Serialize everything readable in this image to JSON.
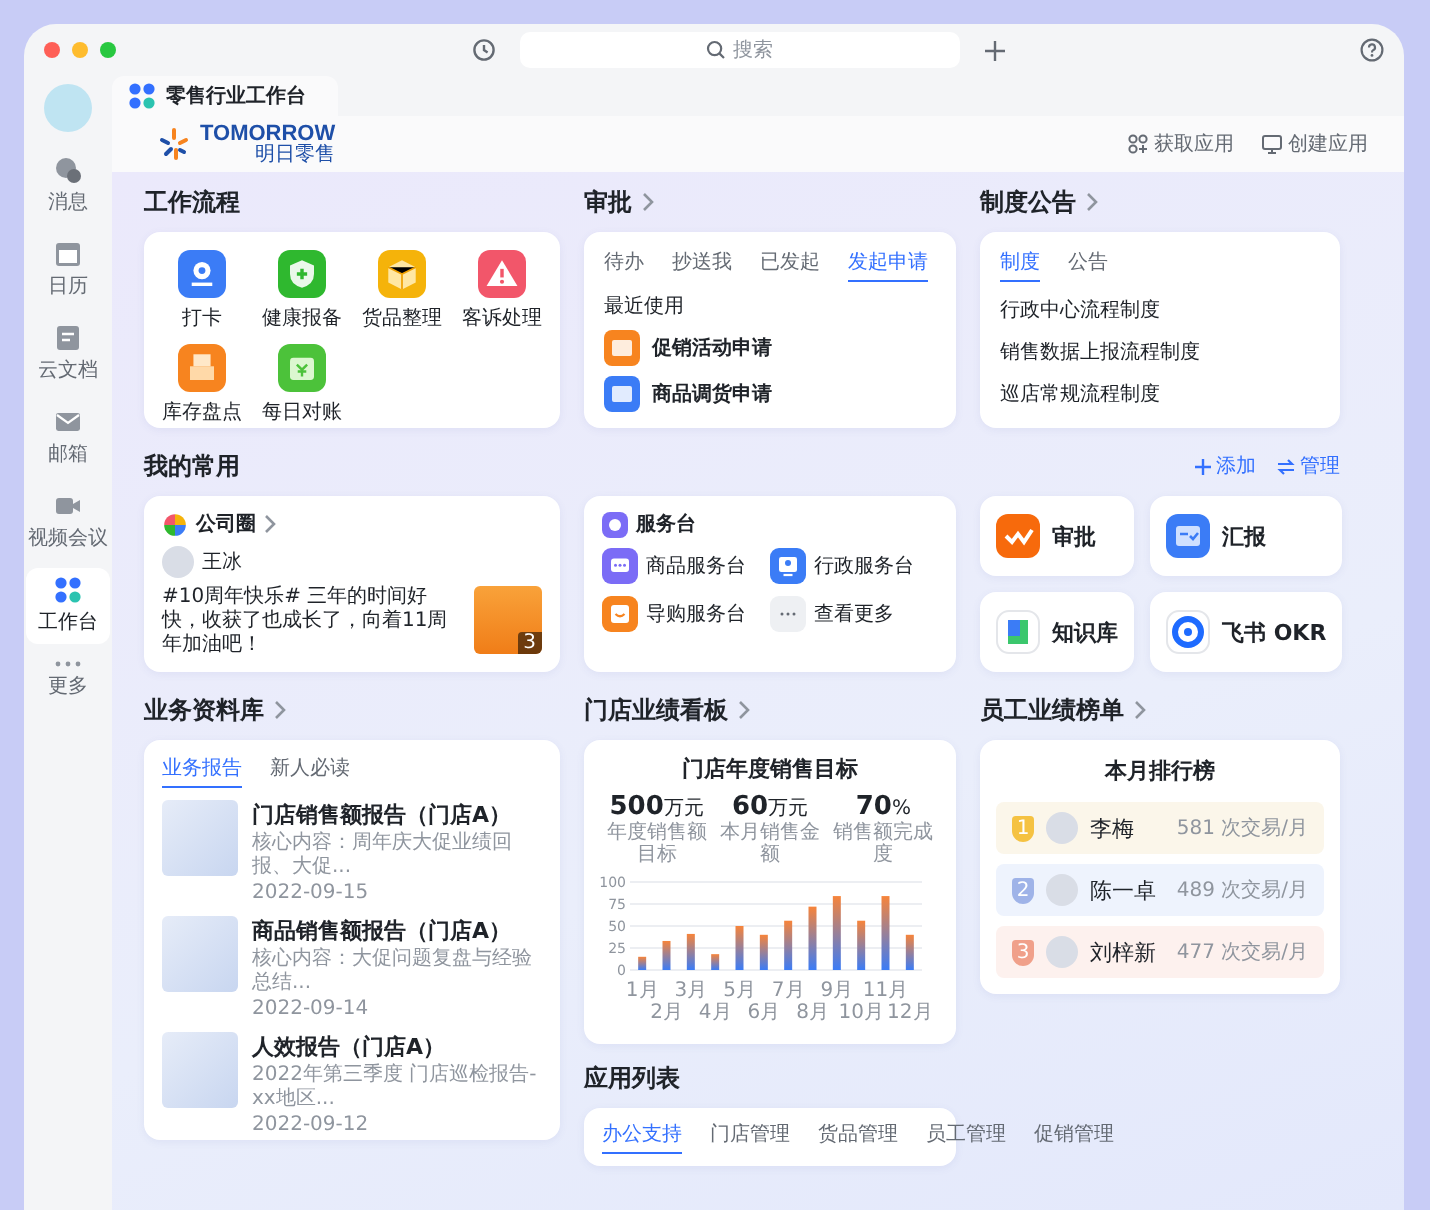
{
  "window": {
    "search_placeholder": "搜索",
    "tab_title": "零售行业工作台"
  },
  "sidebar": {
    "items": [
      {
        "label": "消息",
        "kind": "chat",
        "selected": false
      },
      {
        "label": "日历",
        "kind": "calendar",
        "selected": false
      },
      {
        "label": "云文档",
        "kind": "doc",
        "selected": false
      },
      {
        "label": "邮箱",
        "kind": "mail",
        "selected": false
      },
      {
        "label": "视频会议",
        "kind": "video",
        "selected": false
      },
      {
        "label": "工作台",
        "kind": "apps",
        "selected": true
      },
      {
        "label": "更多",
        "kind": "more",
        "selected": false
      }
    ]
  },
  "header": {
    "logo_text": "TOMORROW",
    "logo_sub": "明日零售",
    "actions": [
      {
        "label": "获取应用",
        "kind": "get"
      },
      {
        "label": "创建应用",
        "kind": "create"
      }
    ]
  },
  "workflow": {
    "title": "工作流程",
    "apps": [
      {
        "label": "打卡",
        "color": "#3b7cf6"
      },
      {
        "label": "健康报备",
        "color": "#2fb82f"
      },
      {
        "label": "货品整理",
        "color": "#f5b30a"
      },
      {
        "label": "客诉处理",
        "color": "#f2566a"
      },
      {
        "label": "库存盘点",
        "color": "#f7841f"
      },
      {
        "label": "每日对账",
        "color": "#4cc23a"
      }
    ]
  },
  "approval": {
    "title": "审批",
    "tabs": [
      {
        "label": "待办",
        "selected": false
      },
      {
        "label": "抄送我",
        "selected": false
      },
      {
        "label": "已发起",
        "selected": false
      },
      {
        "label": "发起申请",
        "selected": true
      }
    ],
    "recent_label": "最近使用",
    "items": [
      {
        "label": "促销活动申请",
        "color": "#f7841f"
      },
      {
        "label": "商品调货申请",
        "color": "#3b7cf6"
      }
    ]
  },
  "notices": {
    "title": "制度公告",
    "tabs": [
      {
        "label": "制度",
        "selected": true
      },
      {
        "label": "公告",
        "selected": false
      }
    ],
    "items": [
      "行政中心流程制度",
      "销售数据上报流程制度",
      "巡店常规流程制度"
    ]
  },
  "favorites": {
    "title": "我的常用",
    "actions": [
      {
        "label": "添加",
        "kind": "add"
      },
      {
        "label": "管理",
        "kind": "manage"
      }
    ]
  },
  "moments": {
    "title": "公司圈",
    "author": "王冰",
    "text": "#10周年快乐# 三年的时间好快，收获了也成长了，向着11周年加油吧！",
    "image_count": "3"
  },
  "service_desk": {
    "title": "服务台",
    "items": [
      {
        "label": "商品服务台",
        "kind": "chat",
        "color": "#7b6cf6"
      },
      {
        "label": "行政服务台",
        "kind": "person",
        "color": "#3b7cf6"
      },
      {
        "label": "导购服务台",
        "kind": "smile",
        "color": "#f7841f"
      },
      {
        "label": "查看更多",
        "kind": "more",
        "color": "#eef0f3"
      }
    ]
  },
  "shortcuts": [
    {
      "label": "审批",
      "kind": "approval"
    },
    {
      "label": "汇报",
      "kind": "report"
    },
    {
      "label": "知识库",
      "kind": "wiki"
    },
    {
      "label": "飞书 OKR",
      "kind": "okr"
    }
  ],
  "library": {
    "title": "业务资料库",
    "tabs": [
      {
        "label": "业务报告",
        "selected": true
      },
      {
        "label": "新人必读",
        "selected": false
      }
    ],
    "items": [
      {
        "title": "门店销售额报告（门店A）",
        "desc": "核心内容：周年庆大促业绩回报、大促...",
        "date": "2022-09-15"
      },
      {
        "title": "商品销售额报告（门店A）",
        "desc": "核心内容：大促问题复盘与经验总结...",
        "date": "2022-09-14"
      },
      {
        "title": "人效报告（门店A）",
        "desc": "2022年第三季度 门店巡检报告-xx地区...",
        "date": "2022-09-12"
      }
    ]
  },
  "dashboard": {
    "title": "门店业绩看板",
    "card_title": "门店年度销售目标",
    "stats": [
      {
        "value": "500",
        "unit": "万元",
        "label": "年度销售额目标"
      },
      {
        "value": "60",
        "unit": "万元",
        "label": "本月销售金额"
      },
      {
        "value": "70",
        "unit": "%",
        "label": "销售额完成度"
      }
    ],
    "chart_data": {
      "type": "bar",
      "categories": [
        "1月",
        "2月",
        "3月",
        "4月",
        "5月",
        "6月",
        "7月",
        "8月",
        "9月",
        "10月",
        "11月",
        "12月"
      ],
      "ylim": [
        0,
        100
      ],
      "yticks": [
        0,
        25,
        50,
        75,
        100
      ],
      "grid": true,
      "series": [
        {
          "color": "#3b7cf6",
          "values": [
            15,
            33,
            41,
            18,
            50,
            40,
            56,
            72,
            84,
            56,
            84,
            40
          ]
        }
      ]
    }
  },
  "ranking": {
    "title": "员工业绩榜单",
    "card_title": "本月排行榜",
    "rows": [
      {
        "rank": "1",
        "name": "李梅",
        "value": "581 次交易/月",
        "color": "#fbf6ea"
      },
      {
        "rank": "2",
        "name": "陈一卓",
        "value": "489 次交易/月",
        "color": "#eef3fd"
      },
      {
        "rank": "3",
        "name": "刘梓新",
        "value": "477 次交易/月",
        "color": "#fdf1ee"
      }
    ]
  },
  "app_list": {
    "title": "应用列表",
    "tabs": [
      {
        "label": "办公支持",
        "selected": true
      },
      {
        "label": "门店管理",
        "selected": false
      },
      {
        "label": "货品管理",
        "selected": false
      },
      {
        "label": "员工管理",
        "selected": false
      },
      {
        "label": "促销管理",
        "selected": false
      }
    ]
  }
}
